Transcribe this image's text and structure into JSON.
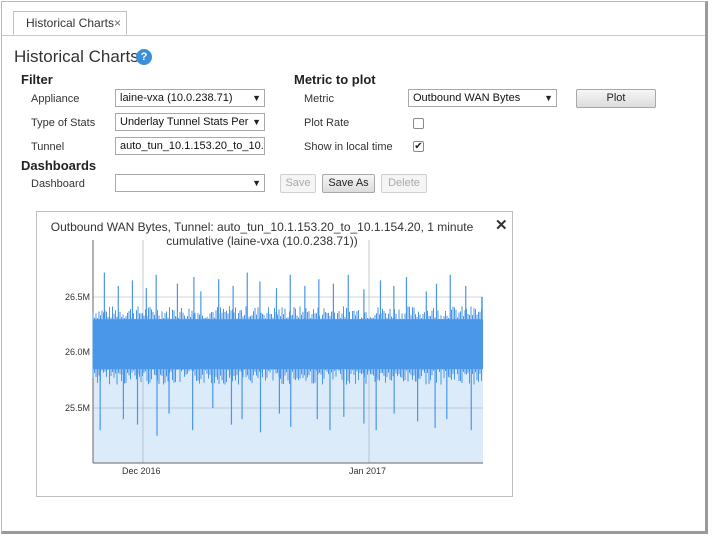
{
  "tab": {
    "label": "Historical Charts",
    "close": "×"
  },
  "page": {
    "title": "Historical Charts",
    "help": "?"
  },
  "filter": {
    "heading": "Filter",
    "appliance_label": "Appliance",
    "appliance_value": "laine-vxa (10.0.238.71)",
    "type_label": "Type of Stats",
    "type_value": "Underlay Tunnel Stats Per",
    "tunnel_label": "Tunnel",
    "tunnel_value": "auto_tun_10.1.153.20_to_10."
  },
  "metric": {
    "heading": "Metric to plot",
    "metric_label": "Metric",
    "metric_value": "Outbound WAN Bytes",
    "plot_button": "Plot",
    "plot_rate_label": "Plot Rate",
    "plot_rate_checked": false,
    "local_time_label": "Show in local time",
    "local_time_checked": true,
    "check_mark": "✔"
  },
  "dashboards": {
    "heading": "Dashboards",
    "dashboard_label": "Dashboard",
    "dashboard_value": "",
    "save": "Save",
    "save_as": "Save As",
    "delete": "Delete"
  },
  "icons": {
    "dropdown": "▼",
    "close_chart": "✕"
  },
  "chart": {
    "title_line1": "Outbound WAN Bytes, Tunnel: auto_tun_10.1.153.20_to_10.1.154.20, 1 minute",
    "title_line2": "cumulative (laine-vxa (10.0.238.71))",
    "series_color": "#4a96e8",
    "fill_color": "#dcebfa"
  },
  "chart_data": {
    "type": "area",
    "title": "Outbound WAN Bytes, Tunnel: auto_tun_10.1.153.20_to_10.1.154.20, 1 minute cumulative (laine-vxa (10.0.238.71))",
    "xlabel": "",
    "ylabel": "",
    "x_ticks": [
      "Dec 2016",
      "Jan 2017"
    ],
    "y_ticks": [
      "25.5M",
      "26.0M",
      "26.5M"
    ],
    "ylim": [
      25.1,
      26.75
    ],
    "grid": true,
    "series": [
      {
        "band_low": 25.85,
        "band_high": 26.3,
        "up_spikes": [
          26.72,
          26.6,
          26.65,
          26.58,
          26.7,
          26.62,
          26.68,
          26.55,
          26.66,
          26.6,
          26.72,
          26.64,
          26.58,
          26.7,
          26.6,
          26.66,
          26.62,
          26.7,
          26.57,
          26.65,
          26.6,
          26.68,
          26.55,
          26.62,
          26.7,
          26.6
        ],
        "down_spikes": [
          25.3,
          25.4,
          25.35,
          25.25,
          25.45,
          25.3,
          25.5,
          25.35,
          25.4,
          25.28,
          25.45,
          25.33,
          25.4,
          25.3,
          25.42,
          25.36,
          25.3,
          25.45,
          25.38,
          25.32,
          25.4,
          25.3
        ],
        "last_value": 26.5
      }
    ]
  }
}
